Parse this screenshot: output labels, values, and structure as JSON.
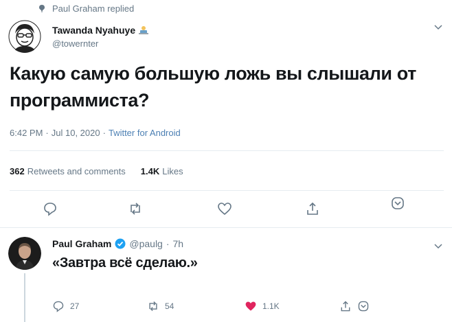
{
  "context": {
    "text": "Paul Graham replied",
    "icon": "pin-icon"
  },
  "tweet": {
    "author_name": "Tawanda Nyahuye",
    "author_emoji": "technologist-emoji",
    "handle": "@towernter",
    "text": "Какую самую большую ложь вы слышали от программиста?",
    "time": "6:42 PM",
    "date": "Jul 10, 2020",
    "separator": "·",
    "source": "Twitter for Android",
    "retweets_count": "362",
    "retweets_label": "Retweets and comments",
    "likes_count": "1.4K",
    "likes_label": "Likes",
    "actions": [
      "reply-icon",
      "retweet-icon",
      "like-icon",
      "share-icon",
      "more-icon"
    ]
  },
  "reply": {
    "author_name": "Paul Graham",
    "verified": true,
    "handle": "@paulg",
    "separator": "·",
    "time": "7h",
    "text": "«Завтра всё сделаю.»",
    "reply_count": "27",
    "retweet_count": "54",
    "like_count": "1.1K",
    "like_color": "#e0245e"
  },
  "colors": {
    "link": "#1da1f2",
    "muted": "#657786",
    "verified": "#1da1f2"
  }
}
